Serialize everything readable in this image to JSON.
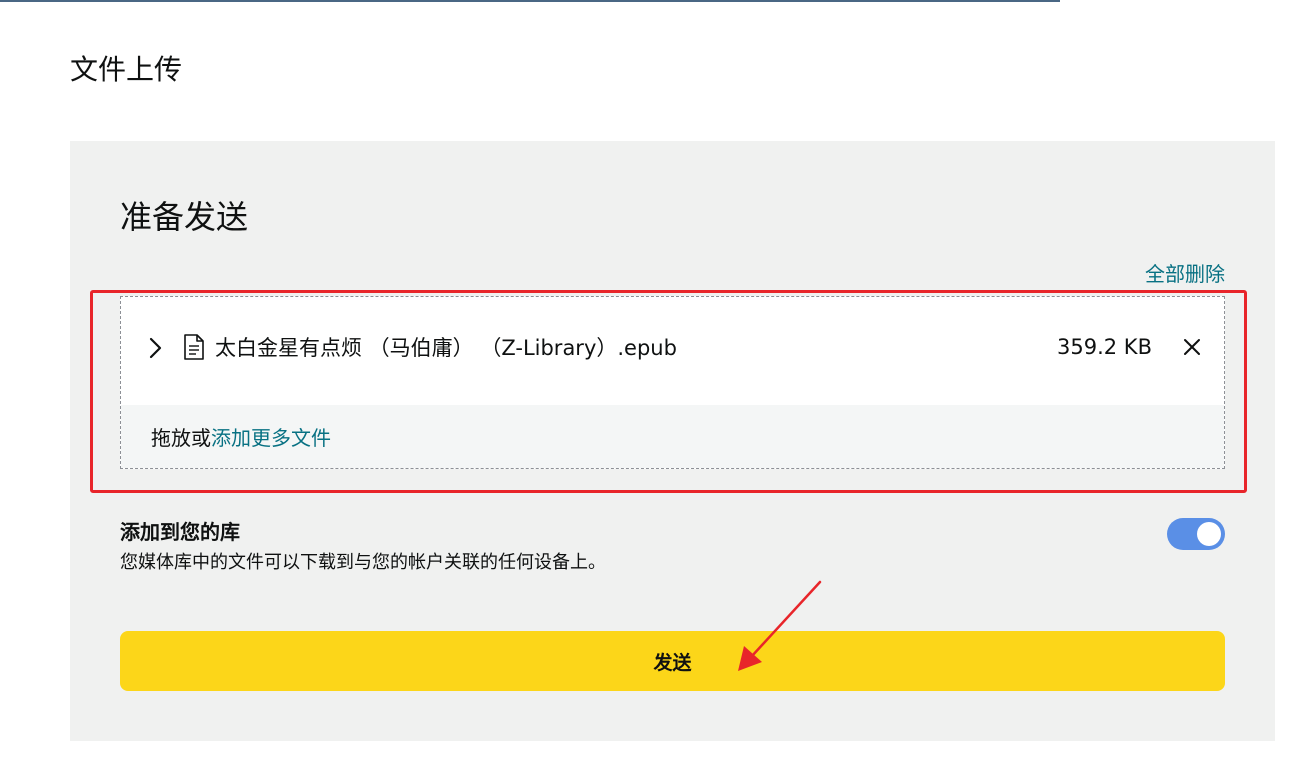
{
  "page": {
    "title": "文件上传"
  },
  "panel": {
    "title": "准备发送",
    "delete_all_label": "全部删除"
  },
  "file": {
    "name": "太白金星有点烦 （马伯庸） （Z-Library）.epub",
    "size": "359.2 KB"
  },
  "drop_zone": {
    "prefix": "拖放或",
    "link_label": "添加更多文件"
  },
  "library": {
    "heading": "添加到您的库",
    "description": "您媒体库中的文件可以下载到与您的帐户关联的任何设备上。",
    "toggle_on": true
  },
  "send_button_label": "发送",
  "colors": {
    "link": "#087183",
    "highlight_frame": "#e8252a",
    "send_button": "#fcd619",
    "toggle": "#5a8fe6",
    "panel_background": "#f0f1f0"
  },
  "icons": {
    "expand": "chevron-right-icon",
    "file": "document-icon",
    "remove": "close-icon"
  }
}
